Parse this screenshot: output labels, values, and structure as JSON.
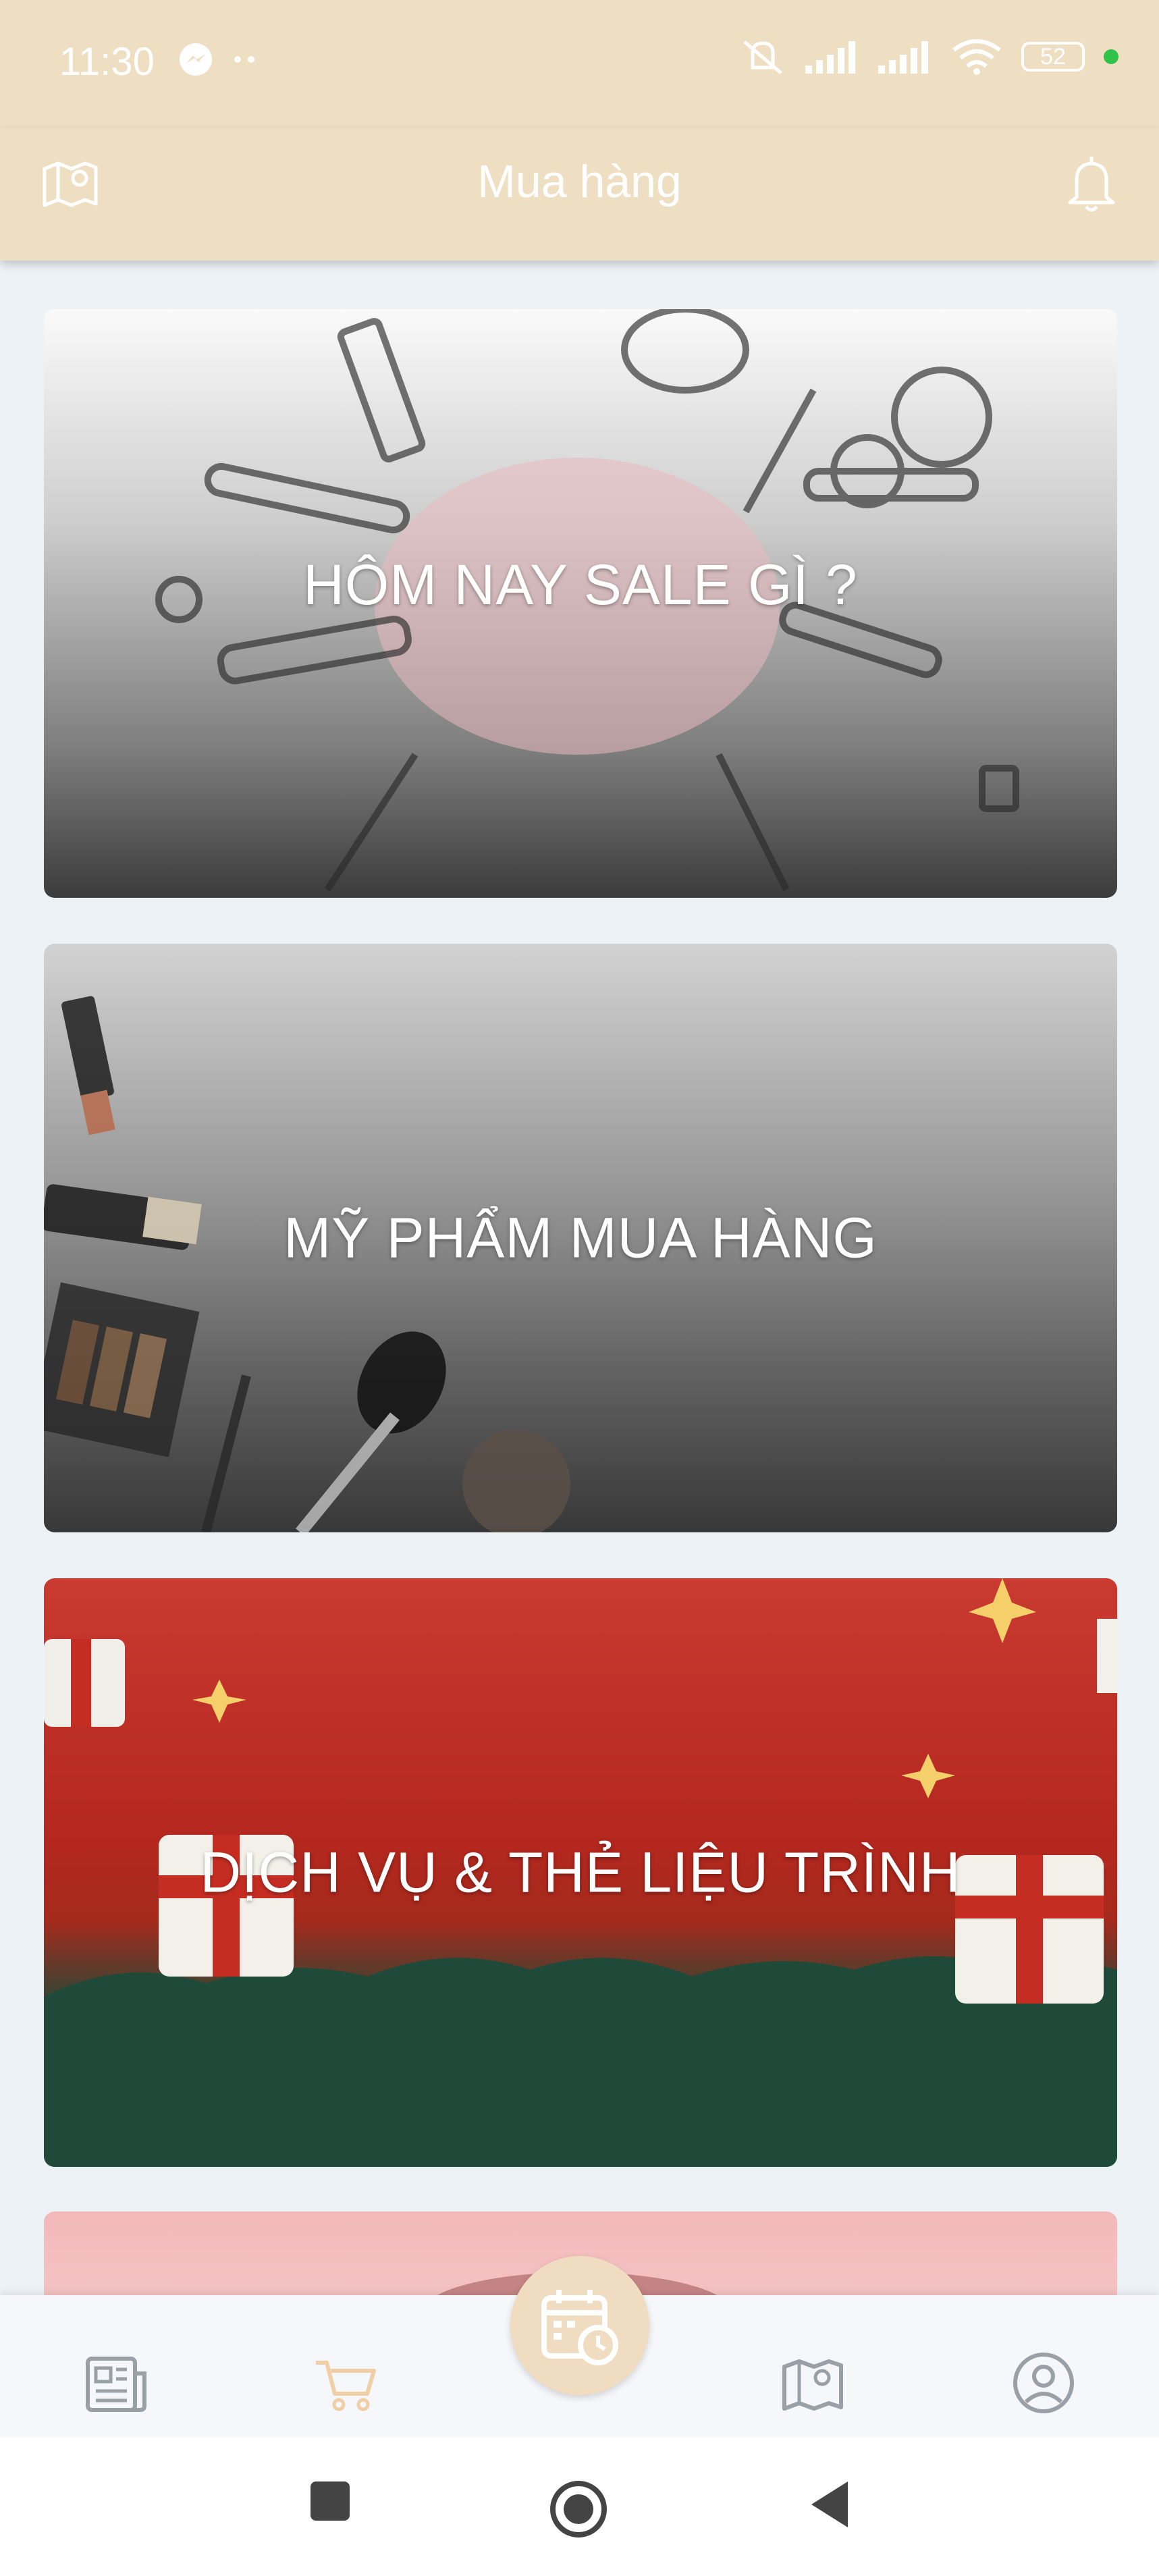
{
  "status_bar": {
    "time": "11:30",
    "battery": "52",
    "dot_color": "#31c24a"
  },
  "header": {
    "title": "Mua hàng",
    "left_icon": "map-pin-icon",
    "right_icon": "bell-icon"
  },
  "cards": [
    {
      "title": "HÔM NAY SALE GÌ ?"
    },
    {
      "title": "MỸ PHẨM MUA HÀNG"
    },
    {
      "title": "DỊCH VỤ & THẺ LIỆU TRÌNH"
    },
    {
      "title": ""
    }
  ],
  "bottom_nav": {
    "items": [
      {
        "icon": "news-icon"
      },
      {
        "icon": "cart-icon",
        "active": true
      },
      {
        "icon": "calendar-clock-icon"
      },
      {
        "icon": "map-pin-icon"
      },
      {
        "icon": "profile-icon"
      }
    ],
    "active_color": "#efcfa5",
    "inactive_color": "#9aa0a8"
  }
}
